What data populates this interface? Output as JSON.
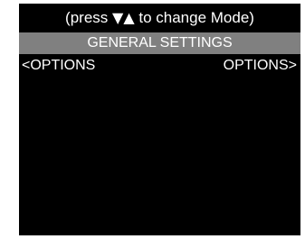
{
  "screen": {
    "background_color": "#000000",
    "header_bar_color": "#808080",
    "text_color": "#ffffff"
  },
  "hint": {
    "prefix": "(press ",
    "down_arrow": "▼",
    "up_arrow": "▲",
    "suffix": " to change Mode)"
  },
  "title": "GENERAL SETTINGS",
  "nav": {
    "prev_label": "<OPTIONS",
    "next_label": "OPTIONS>"
  }
}
